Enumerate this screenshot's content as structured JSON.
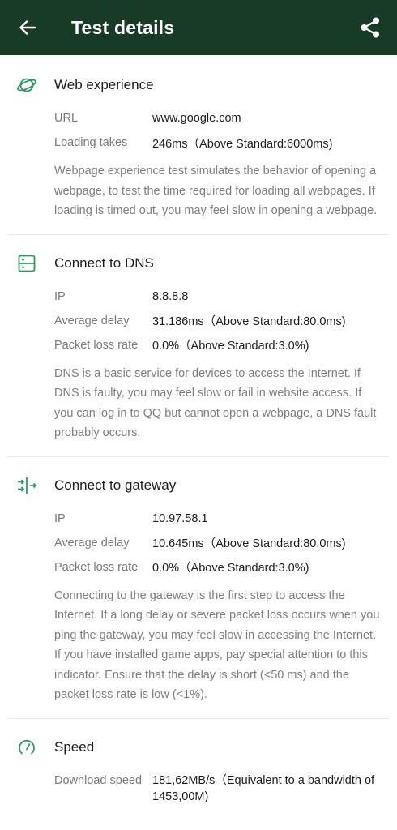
{
  "header": {
    "title": "Test details"
  },
  "web": {
    "title": "Web experience",
    "rows": [
      {
        "label": "URL",
        "value": "www.google.com"
      },
      {
        "label": "Loading takes",
        "value": "246ms（Above Standard:6000ms)"
      }
    ],
    "description": "Webpage experience test simulates the behavior of opening a webpage, to test the time required for loading all webpages. If loading is timed out, you may feel slow in opening a webpage."
  },
  "dns": {
    "title": "Connect to DNS",
    "rows": [
      {
        "label": "IP",
        "value": "8.8.8.8"
      },
      {
        "label": "Average delay",
        "value": "31.186ms（Above Standard:80.0ms)"
      },
      {
        "label": "Packet loss rate",
        "value": "0.0%（Above Standard:3.0%)"
      }
    ],
    "description": "DNS is a basic service for devices to access the Internet. If DNS is faulty, you may feel slow or fail in website access. If you can log in to QQ but cannot open a webpage, a DNS fault probably occurs."
  },
  "gateway": {
    "title": "Connect to gateway",
    "rows": [
      {
        "label": "IP",
        "value": "10.97.58.1"
      },
      {
        "label": "Average delay",
        "value": "10.645ms（Above Standard:80.0ms)"
      },
      {
        "label": "Packet loss rate",
        "value": "0.0%（Above Standard:3.0%)"
      }
    ],
    "description": "Connecting to the gateway is the first step to access the Internet. If a long delay or severe packet loss occurs when you ping the gateway, you may feel slow in accessing the Internet. If you have installed game apps, pay special attention to this indicator. Ensure that the delay is short (<50 ms) and the packet loss rate is low (<1%)."
  },
  "speed": {
    "title": "Speed",
    "rows": [
      {
        "label": "Download speed",
        "value": "181,62MB/s（Equivalent to a bandwidth of 1453,00M)"
      }
    ]
  },
  "colors": {
    "appbar": "#173b24",
    "accent": "#2e9b5c"
  },
  "icons": {
    "back": "arrow-left-icon",
    "share": "share-icon",
    "web": "planet-icon",
    "dns": "server-icon",
    "gateway": "gateway-arrows-icon",
    "speed": "speedometer-icon"
  }
}
